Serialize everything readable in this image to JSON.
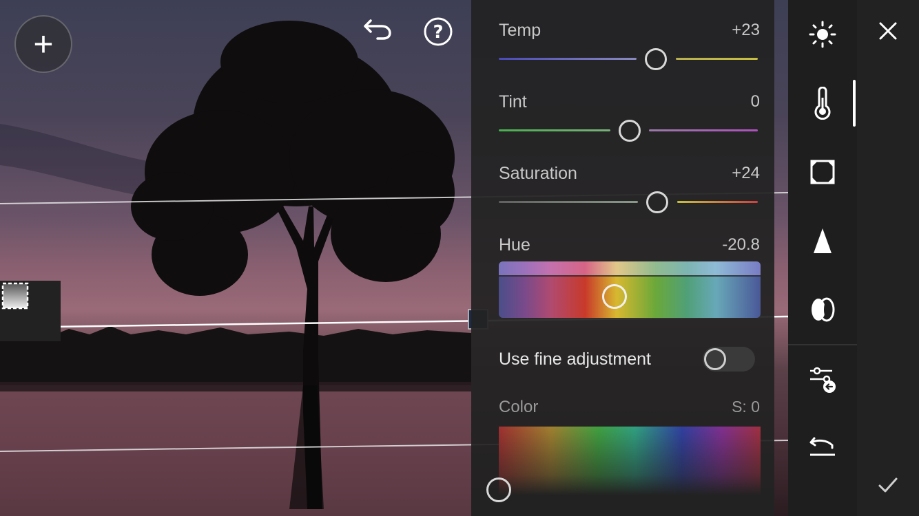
{
  "top_bar": {
    "add_icon": "plus-icon",
    "undo_icon": "undo-icon",
    "help_icon": "help-icon"
  },
  "left_tools": {
    "mask_icon": "linear-gradient-mask-icon"
  },
  "adjustments": {
    "temp": {
      "label": "Temp",
      "value": "+23",
      "fraction": 0.61
    },
    "tint": {
      "label": "Tint",
      "value": "0",
      "fraction": 0.5
    },
    "saturation": {
      "label": "Saturation",
      "value": "+24",
      "fraction": 0.62
    },
    "hue": {
      "label": "Hue",
      "value": "-20.8",
      "fraction": 0.44
    }
  },
  "fine_adjustment": {
    "label": "Use fine adjustment",
    "enabled": false
  },
  "color": {
    "label": "Color",
    "value": "S: 0"
  },
  "toolbar": {
    "items": [
      {
        "name": "light-icon"
      },
      {
        "name": "temperature-icon",
        "active": true
      },
      {
        "name": "vignette-icon"
      },
      {
        "name": "sharpen-icon"
      },
      {
        "name": "optics-icon"
      },
      {
        "name": "mask-adjust-icon"
      },
      {
        "name": "reset-icon"
      }
    ]
  },
  "sidebar": {
    "close_icon": "close-icon",
    "confirm_icon": "check-icon"
  },
  "colors": {
    "panel_bg": "#222222",
    "toolbar_bg": "#1e1e1e",
    "temp_left": "#4a4ab8",
    "temp_right": "#c8c040",
    "tint_left": "#4ab050",
    "tint_right": "#b050c0",
    "sat_left": "#707070",
    "sat_right": "#d04040"
  }
}
